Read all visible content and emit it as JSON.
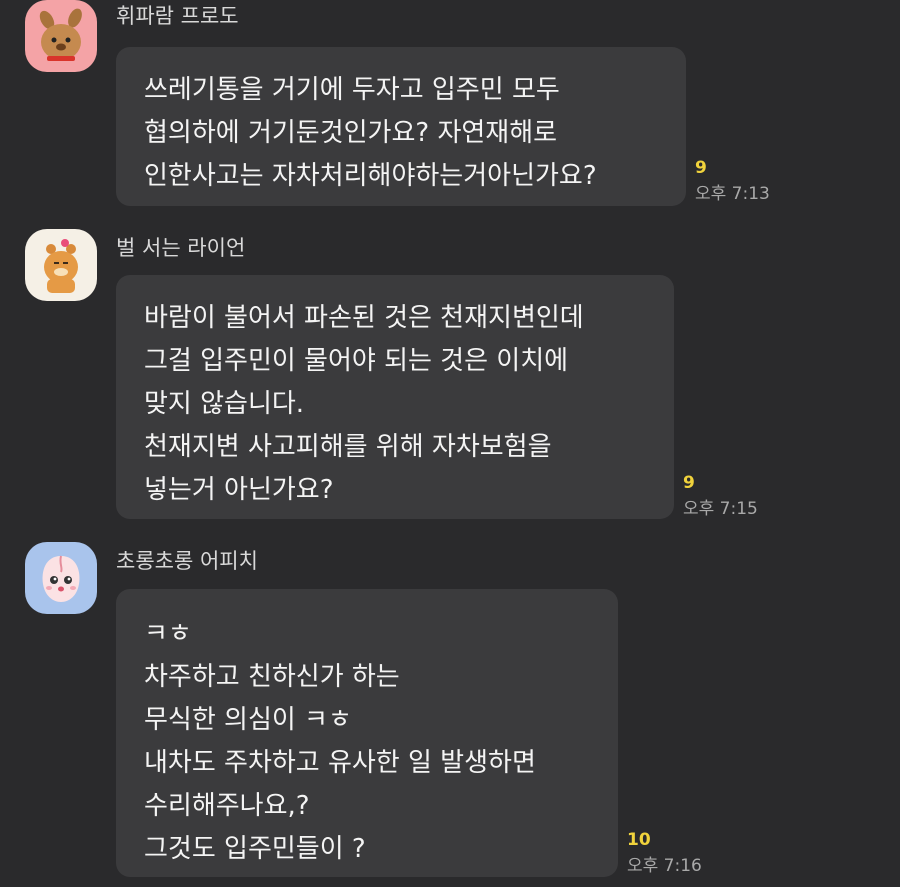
{
  "messages": [
    {
      "sender": "휘파람 프로도",
      "avatar_icon": "frodo-dog-avatar-icon",
      "avatar_color": "#f4a3a6",
      "lines": [
        "쓰레기통을 거기에 두자고 입주민 모두",
        "협의하에 거기둔것인가요? 자연재해로",
        "인한사고는 자차처리해야하는거아닌가요?"
      ],
      "unread": "9",
      "time": "오후 7:13"
    },
    {
      "sender": "벌 서는 라이언",
      "avatar_icon": "ryan-lion-avatar-icon",
      "avatar_color": "#f5f0e6",
      "lines": [
        "바람이 불어서 파손된 것은 천재지변인데",
        "그걸 입주민이 물어야 되는 것은 이치에",
        "맞지 않습니다.",
        "천재지변 사고피해를 위해 자차보험을",
        "넣는거 아닌가요?"
      ],
      "unread": "9",
      "time": "오후 7:15"
    },
    {
      "sender": "초롱초롱 어피치",
      "avatar_icon": "apeach-avatar-icon",
      "avatar_color": "#a9c4ec",
      "lines": [
        "ㅋㅎ",
        "차주하고 친하신가 하는",
        "무식한 의심이 ㅋㅎ",
        "내차도 주차하고 유사한 일 발생하면",
        "수리해주나요,?",
        "그것도 입주민들이 ?"
      ],
      "unread": "10",
      "time": "오후 7:16"
    }
  ],
  "colors": {
    "background": "#2a2a2c",
    "bubble": "#3b3b3d",
    "unread": "#f1d33c",
    "time": "#a9a9a9"
  }
}
